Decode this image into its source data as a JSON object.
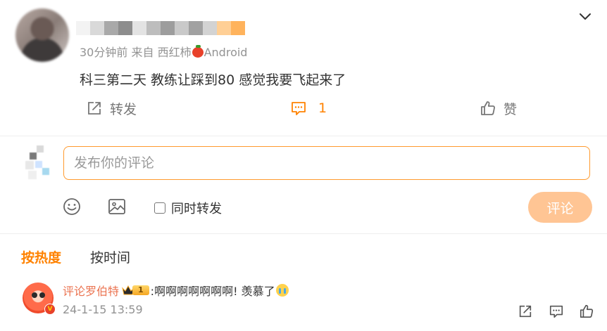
{
  "post": {
    "meta": {
      "time": "30分钟前",
      "from_prefix": "来自",
      "source_app": "西红柿",
      "platform": "Android",
      "source_icon": "tomato-icon"
    },
    "text": "科三第二天 教练让踩到80  感觉我要飞起来了",
    "actions": {
      "repost_label": "转发",
      "comment_count": "1",
      "like_label": "赞"
    }
  },
  "composer": {
    "placeholder": "发布你的评论",
    "repost_checkbox_label": "同时转发",
    "repost_checked": false,
    "submit_label": "评论",
    "icons": [
      "emoji-icon",
      "image-icon"
    ]
  },
  "sort": {
    "hot_label": "按热度",
    "time_label": "按时间",
    "active": "hot"
  },
  "comments": [
    {
      "username": "评论罗伯特",
      "vip_level": "1",
      "text": ":啊啊啊啊啊啊啊!  羡慕了",
      "emoji": "crying-face-icon",
      "timestamp": "24-1-15 13:59",
      "badge": "V"
    }
  ],
  "colors": {
    "accent": "#ff8200",
    "input_border": "#ff9a2e",
    "submit_bg": "#ffc594",
    "username": "#eb7350",
    "meta_gray": "#939393"
  }
}
